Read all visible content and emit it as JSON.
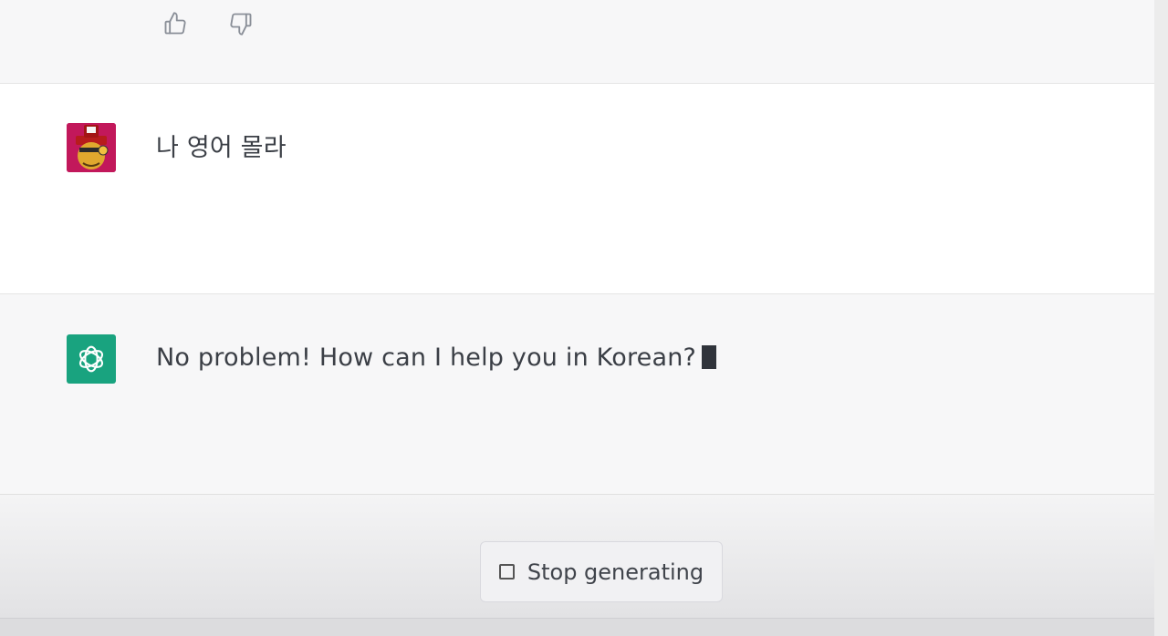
{
  "feedback": {
    "thumbs_up_icon": "thumbs-up-icon",
    "thumbs_down_icon": "thumbs-down-icon"
  },
  "conversation": [
    {
      "role": "user",
      "text": "나 영어 몰라",
      "avatar": "user-avatar"
    },
    {
      "role": "assistant",
      "text": "No problem! How can I help you in Korean?",
      "avatar": "openai-logo-icon",
      "streaming": true
    }
  ],
  "controls": {
    "stop_label": "Stop generating"
  },
  "colors": {
    "assistant_bg": "#f7f7f8",
    "user_bg": "#ffffff",
    "assistant_avatar": "#19a37f",
    "user_avatar_bg": "#c2185b"
  }
}
